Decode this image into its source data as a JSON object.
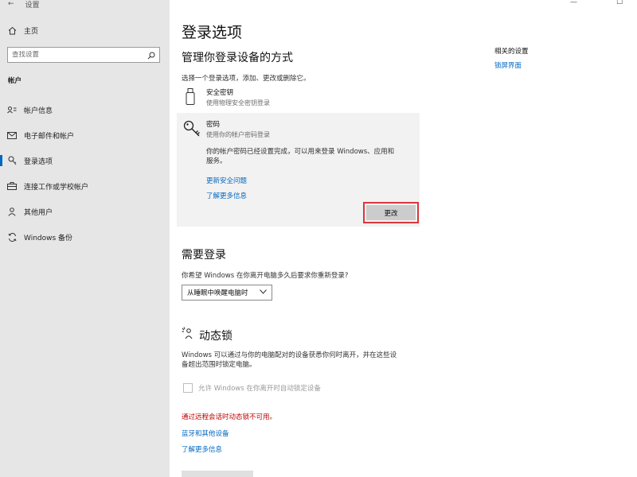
{
  "sidebar": {
    "back_label": "设置",
    "home_label": "主页",
    "search_placeholder": "查找设置",
    "section_label": "帐户",
    "items": [
      {
        "label": "帐户信息",
        "icon": "person-card-icon"
      },
      {
        "label": "电子邮件和帐户",
        "icon": "mail-icon"
      },
      {
        "label": "登录选项",
        "icon": "key-icon"
      },
      {
        "label": "连接工作或学校帐户",
        "icon": "briefcase-icon"
      },
      {
        "label": "其他用户",
        "icon": "person-icon"
      },
      {
        "label": "Windows 备份",
        "icon": "sync-icon"
      }
    ],
    "active_index": 2
  },
  "window": {
    "minimize": "—",
    "maximize": "☐"
  },
  "main": {
    "title": "登录选项",
    "manage_heading": "管理你登录设备的方式",
    "choose_text": "选择一个登录选项，添加、更改或删除它。",
    "security_key": {
      "title": "安全密钥",
      "desc": "使用物理安全密钥登录"
    },
    "password": {
      "title": "密码",
      "desc": "使用你的帐户密码登录",
      "info_line1": "你的帐户密码已经设置完成，可以用来登录 Windows、应用和",
      "info_line2": "服务。",
      "link_update_questions": "更新安全问题",
      "link_learn_more": "了解更多信息",
      "change_button": "更改"
    },
    "related": {
      "heading": "相关的设置",
      "lock_screen_link": "锁屏界面"
    },
    "require_signin": {
      "heading": "需要登录",
      "question": "你希望 Windows 在你离开电脑多久后要求你重新登录?",
      "dropdown_value": "从睡眠中唤醒电脑时"
    },
    "dynamic_lock": {
      "heading": "动态锁",
      "desc_line1": "Windows 可以通过与你的电脑配对的设备获悉你何时离开，并在这些设",
      "desc_line2": "备超出范围时锁定电脑。",
      "checkbox_label": "允许 Windows 在你离开时自动锁定设备",
      "checkbox_checked": false,
      "error_text": "通过远程会话时动态锁不可用。",
      "link_bluetooth": "蓝牙和其他设备",
      "link_learn_more": "了解更多信息"
    }
  },
  "colors": {
    "accent": "#0067c0",
    "error": "#c00000",
    "highlight_border": "#d9363e",
    "sidebar_bg": "#e6e6e6",
    "panel_bg": "#f2f2f2"
  }
}
